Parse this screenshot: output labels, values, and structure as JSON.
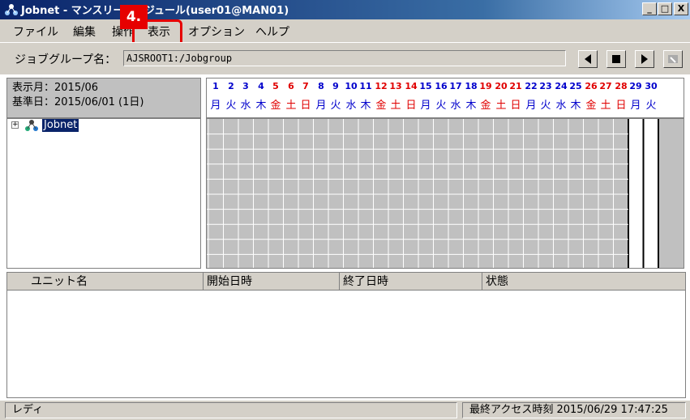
{
  "window": {
    "title": "Jobnet - マンスリースケジュール(user01@MAN01)",
    "minimize": "_",
    "maximize": "□",
    "close": "X"
  },
  "menu": {
    "items": [
      "ファイル",
      "編集",
      "操作",
      "表示",
      "オプション",
      "ヘルプ"
    ]
  },
  "callout": {
    "label": "4."
  },
  "jobgroup": {
    "label": "ジョブグループ名：",
    "value": "AJSROOT1:/Jobgroup"
  },
  "info": {
    "display_month": "表示月：2015/06",
    "base_date": "基準日：2015/06/01 (1日)"
  },
  "tree": {
    "expander": "+",
    "item": "Jobnet"
  },
  "calendar": {
    "days": [
      {
        "n": "1",
        "wd": "月",
        "c": "blue"
      },
      {
        "n": "2",
        "wd": "火",
        "c": "blue"
      },
      {
        "n": "3",
        "wd": "水",
        "c": "blue"
      },
      {
        "n": "4",
        "wd": "木",
        "c": "blue"
      },
      {
        "n": "5",
        "wd": "金",
        "c": "red"
      },
      {
        "n": "6",
        "wd": "土",
        "c": "red"
      },
      {
        "n": "7",
        "wd": "日",
        "c": "red"
      },
      {
        "n": "8",
        "wd": "月",
        "c": "blue"
      },
      {
        "n": "9",
        "wd": "火",
        "c": "blue"
      },
      {
        "n": "10",
        "wd": "水",
        "c": "blue"
      },
      {
        "n": "11",
        "wd": "木",
        "c": "blue"
      },
      {
        "n": "12",
        "wd": "金",
        "c": "red"
      },
      {
        "n": "13",
        "wd": "土",
        "c": "red"
      },
      {
        "n": "14",
        "wd": "日",
        "c": "red"
      },
      {
        "n": "15",
        "wd": "月",
        "c": "blue"
      },
      {
        "n": "16",
        "wd": "火",
        "c": "blue"
      },
      {
        "n": "17",
        "wd": "水",
        "c": "blue"
      },
      {
        "n": "18",
        "wd": "木",
        "c": "blue"
      },
      {
        "n": "19",
        "wd": "金",
        "c": "red"
      },
      {
        "n": "20",
        "wd": "土",
        "c": "red"
      },
      {
        "n": "21",
        "wd": "日",
        "c": "red"
      },
      {
        "n": "22",
        "wd": "月",
        "c": "blue"
      },
      {
        "n": "23",
        "wd": "火",
        "c": "blue"
      },
      {
        "n": "24",
        "wd": "水",
        "c": "blue"
      },
      {
        "n": "25",
        "wd": "木",
        "c": "blue"
      },
      {
        "n": "26",
        "wd": "金",
        "c": "red"
      },
      {
        "n": "27",
        "wd": "土",
        "c": "red"
      },
      {
        "n": "28",
        "wd": "日",
        "c": "red"
      },
      {
        "n": "29",
        "wd": "月",
        "c": "blue"
      },
      {
        "n": "30",
        "wd": "火",
        "c": "blue"
      }
    ],
    "colors": {
      "blue": "#0000cc",
      "red": "#e00000"
    }
  },
  "list": {
    "columns": [
      "ユニット名",
      "開始日時",
      "終了日時",
      "状態"
    ]
  },
  "status": {
    "left": "レディ",
    "right": "最終アクセス時刻 2015/06/29 17:47:25"
  }
}
